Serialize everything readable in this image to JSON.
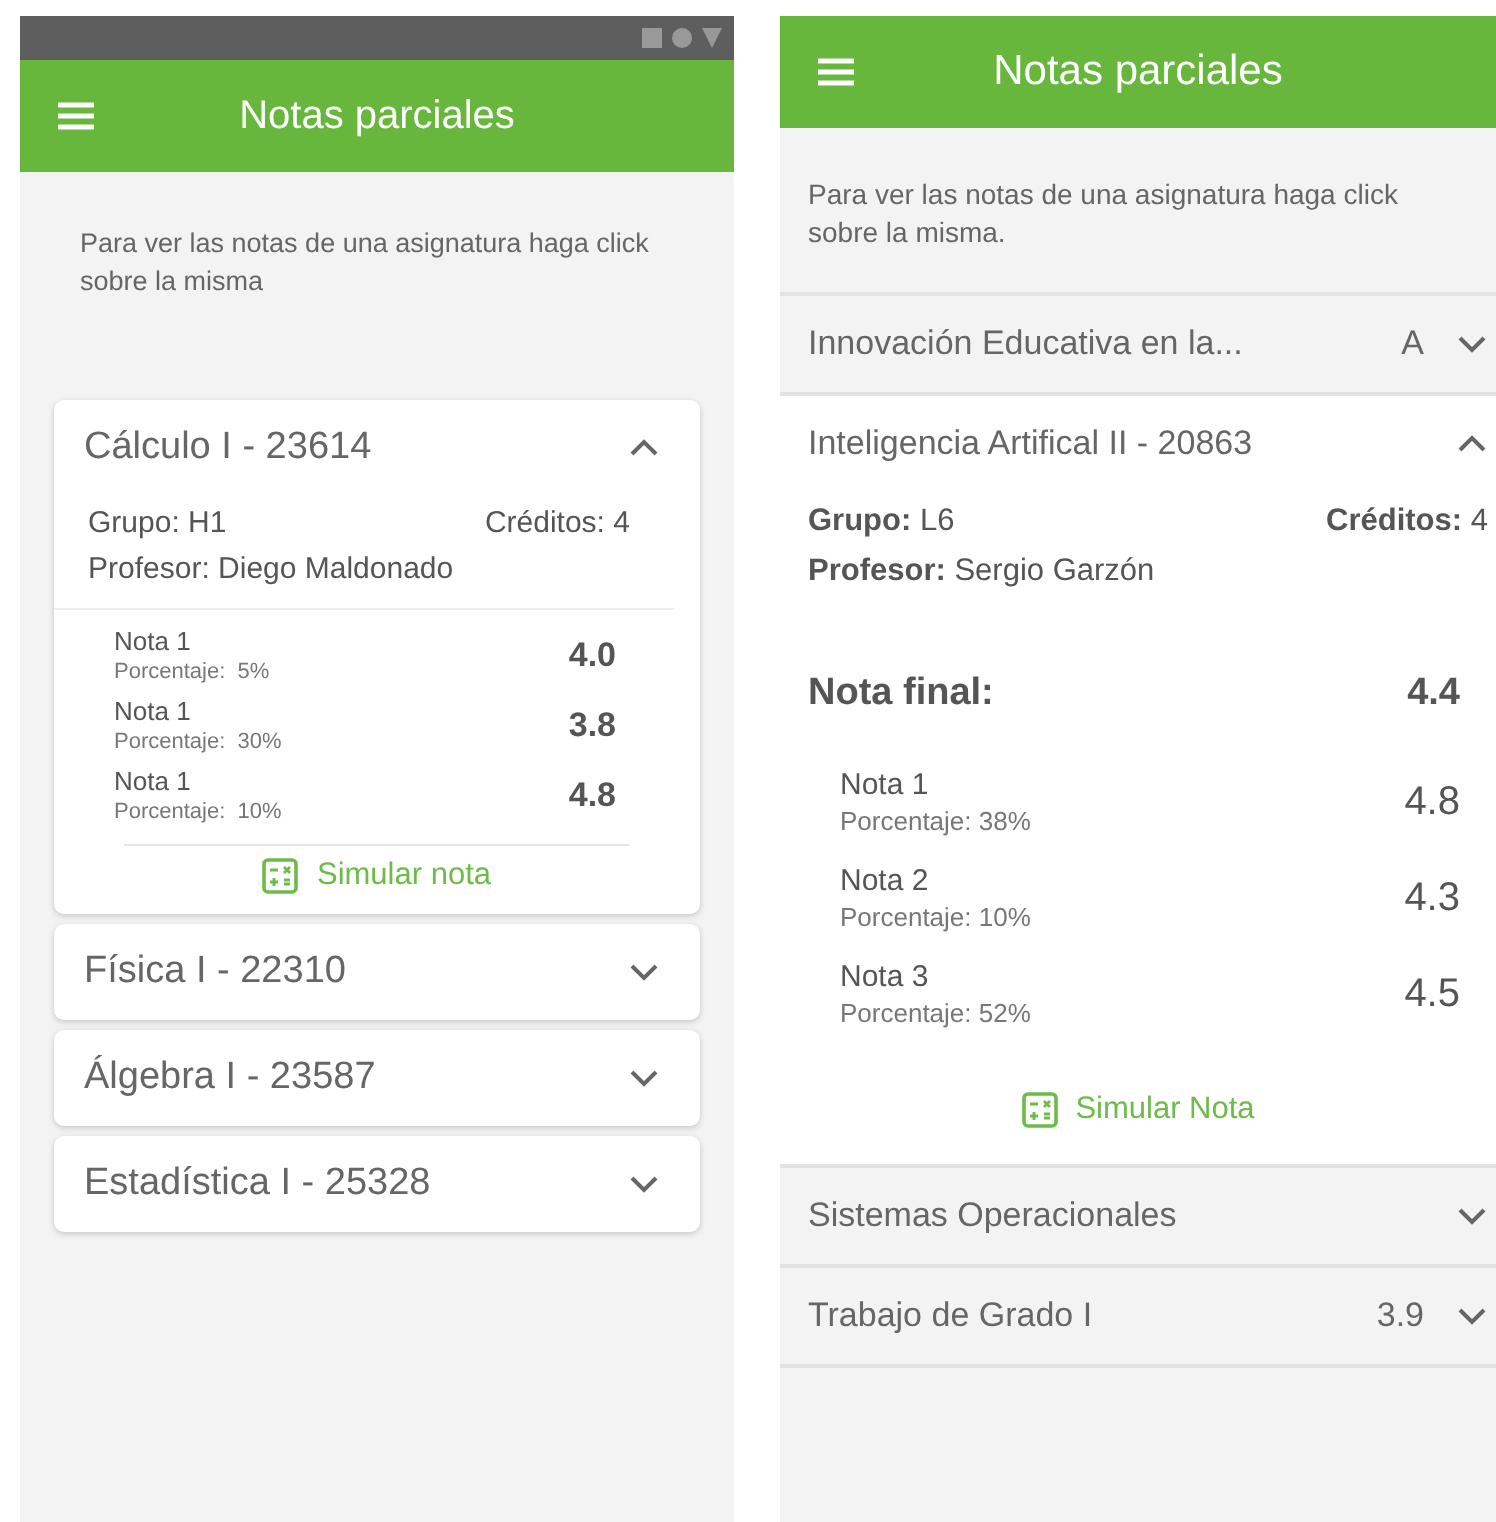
{
  "screens": [
    {
      "kind": "cards",
      "status_bar": true,
      "app_bar": {
        "title": "Notas parciales"
      },
      "intro": "Para ver las notas de una asignatura haga click sobre la misma",
      "subjects": [
        {
          "title": "Cálculo I - 23614",
          "expanded": true,
          "group": "Grupo: H1",
          "credits": "Créditos: 4",
          "professor": "Profesor: Diego Maldonado",
          "notes": [
            {
              "label": "Nota 1",
              "percentage": "Porcentaje:  5%",
              "value": "4.0"
            },
            {
              "label": "Nota 1",
              "percentage": "Porcentaje:  30%",
              "value": "3.8"
            },
            {
              "label": "Nota 1",
              "percentage": "Porcentaje:  10%",
              "value": "4.8"
            }
          ],
          "simulate": "Simular nota"
        },
        {
          "title": "Física I - 22310",
          "expanded": false
        },
        {
          "title": "Álgebra I - 23587",
          "expanded": false
        },
        {
          "title": "Estadística I - 25328",
          "expanded": false
        }
      ]
    },
    {
      "kind": "list",
      "status_bar": false,
      "app_bar": {
        "title": "Notas parciales"
      },
      "intro": "Para ver las notas de una asignatura haga click sobre la misma.",
      "subjects": [
        {
          "title": "Innovación Educativa en la...",
          "grade": "A",
          "expanded": false
        },
        {
          "title": "Inteligencia Artifical II - 20863",
          "expanded": true,
          "group": "**Grupo:** L6",
          "credits": "**Créditos:** 4",
          "professor": "**Profesor:** Sergio Garzón",
          "final_label": "Nota final:",
          "final": "4.4",
          "notes": [
            {
              "label": "Nota 1",
              "percentage": "Porcentaje: 38%",
              "value": "4.8"
            },
            {
              "label": "Nota 2",
              "percentage": "Porcentaje: 10%",
              "value": "4.3"
            },
            {
              "label": "Nota 3",
              "percentage": "Porcentaje: 52%",
              "value": "4.5"
            }
          ],
          "simulate": "Simular Nota"
        },
        {
          "title": "Sistemas Operacionales",
          "expanded": false
        },
        {
          "title": "Trabajo de Grado I",
          "grade": "3.9",
          "expanded": false
        }
      ]
    }
  ]
}
